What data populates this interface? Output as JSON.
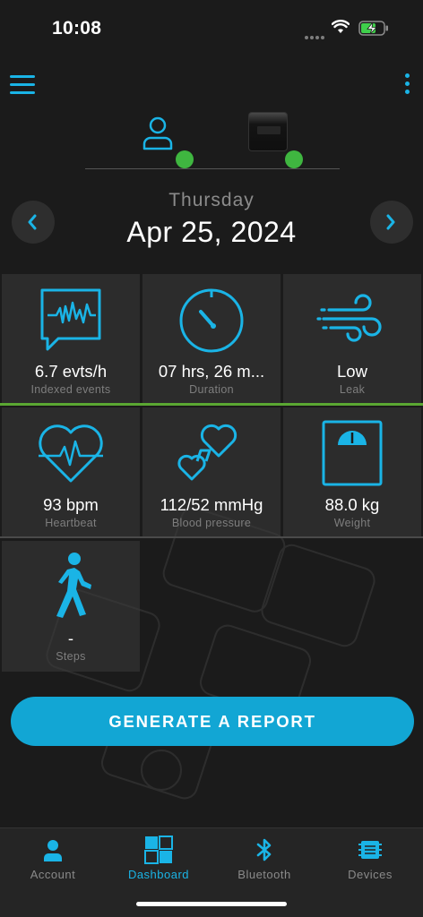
{
  "status_bar": {
    "time": "10:08",
    "icons": [
      "cellular-dots-icon",
      "wifi-icon",
      "battery-charging-icon"
    ]
  },
  "header": {
    "menu_icon": "menu-icon",
    "more_icon": "more-vertical-icon",
    "user_connected": true,
    "device_connected": true,
    "connected_color": "#3fb640"
  },
  "date_nav": {
    "day": "Thursday",
    "date": "Apr 25, 2024",
    "prev_icon": "chevron-left-icon",
    "next_icon": "chevron-right-icon"
  },
  "tiles": [
    {
      "value": "6.7 evts/h",
      "label": "Indexed events",
      "icon": "events-chart-icon"
    },
    {
      "value": "07 hrs, 26 m...",
      "label": "Duration",
      "icon": "timer-icon"
    },
    {
      "value": "Low",
      "label": "Leak",
      "icon": "wind-icon"
    },
    {
      "value": "93 bpm",
      "label": "Heartbeat",
      "icon": "heart-pulse-icon"
    },
    {
      "value": "112/52 mmHg",
      "label": "Blood pressure",
      "icon": "blood-pressure-hearts-icon"
    },
    {
      "value": "88.0 kg",
      "label": "Weight",
      "icon": "scale-icon"
    },
    {
      "value": "-",
      "label": "Steps",
      "icon": "walking-icon"
    }
  ],
  "report_button": "GENERATE A REPORT",
  "tab_bar": {
    "tabs": [
      {
        "label": "Account",
        "icon": "person-icon",
        "active": false
      },
      {
        "label": "Dashboard",
        "icon": "dashboard-grid-icon",
        "active": true
      },
      {
        "label": "Bluetooth",
        "icon": "bluetooth-icon",
        "active": false
      },
      {
        "label": "Devices",
        "icon": "device-chip-icon",
        "active": false
      }
    ]
  },
  "colors": {
    "accent": "#1ab4e6",
    "button": "#12a6d4",
    "background": "#1b1b1b",
    "status_green": "#3fb640",
    "row_separator_green": "#5aa732"
  }
}
